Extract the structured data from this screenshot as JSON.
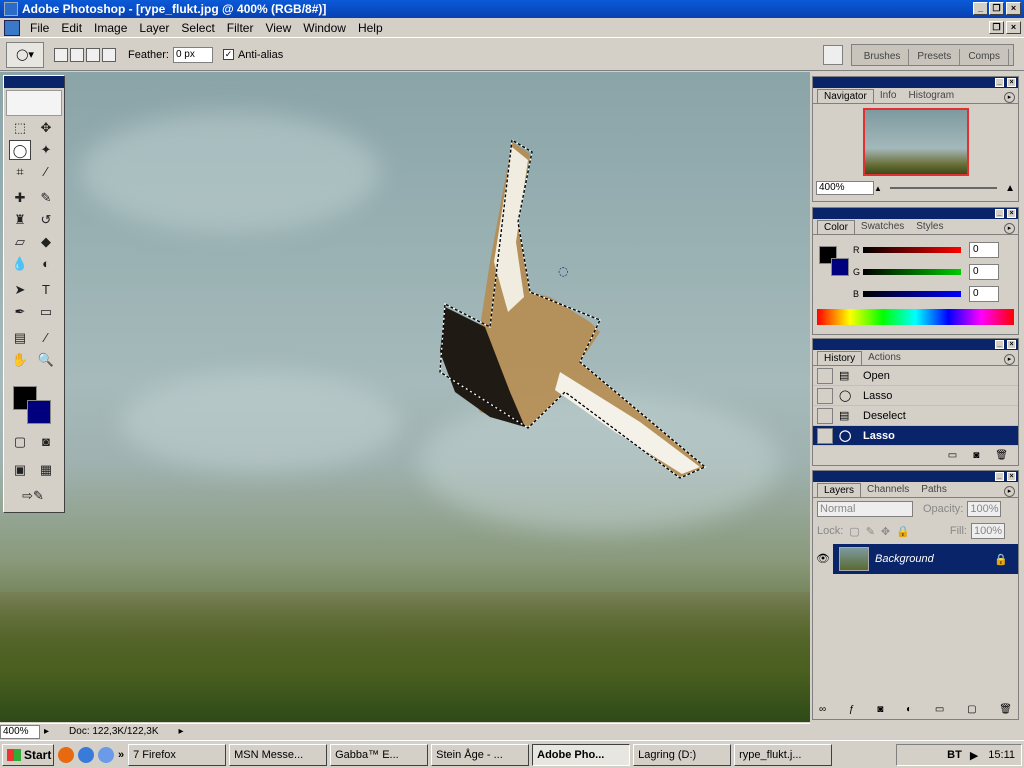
{
  "window": {
    "title": "Adobe Photoshop - [rype_flukt.jpg @ 400% (RGB/8#)]"
  },
  "menu": [
    "File",
    "Edit",
    "Image",
    "Layer",
    "Select",
    "Filter",
    "View",
    "Window",
    "Help"
  ],
  "options": {
    "feather_label": "Feather:",
    "feather_value": "0 px",
    "antialias_label": "Anti-alias",
    "antialias_checked": "✓"
  },
  "palette_well": [
    "Brushes",
    "Presets",
    "Comps"
  ],
  "navigator": {
    "tabs": [
      "Navigator",
      "Info",
      "Histogram"
    ],
    "zoom": "400%"
  },
  "color": {
    "tabs": [
      "Color",
      "Swatches",
      "Styles"
    ],
    "channels": [
      {
        "label": "R",
        "value": "0"
      },
      {
        "label": "G",
        "value": "0"
      },
      {
        "label": "B",
        "value": "0"
      }
    ]
  },
  "history": {
    "tabs": [
      "History",
      "Actions"
    ],
    "items": [
      "Open",
      "Lasso",
      "Deselect",
      "Lasso"
    ]
  },
  "layers": {
    "tabs": [
      "Layers",
      "Channels",
      "Paths"
    ],
    "blend": "Normal",
    "opacity_label": "Opacity:",
    "opacity": "100%",
    "lock_label": "Lock:",
    "fill_label": "Fill:",
    "fill": "100%",
    "layer_name": "Background"
  },
  "status": {
    "zoom": "400%",
    "doc": "Doc: 122,3K/122,3K"
  },
  "taskbar": {
    "start": "Start",
    "tasks": [
      "7 Firefox",
      "MSN Messe...",
      "Gabba™   E...",
      "Stein Åge - ...",
      "Adobe Pho...",
      "Lagring (D:)",
      "rype_flukt.j..."
    ],
    "tray_text": "BT",
    "clock": "15:11"
  }
}
